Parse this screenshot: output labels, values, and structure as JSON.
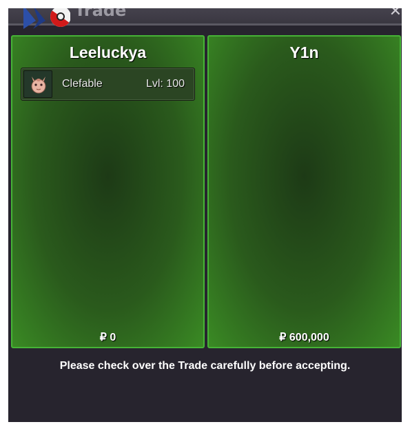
{
  "window": {
    "title": "Trade",
    "close_label": "✕"
  },
  "left_panel": {
    "trainer_name": "Leeluckya",
    "items": [
      {
        "name": "Clefable",
        "level": "Lvl: 100",
        "icon": "clefable-sprite-icon"
      }
    ],
    "money_symbol": "₽",
    "money": "0"
  },
  "right_panel": {
    "trainer_name": "Y1n",
    "items": [],
    "money_symbol": "₽",
    "money": "600,000"
  },
  "notice": "Please check over the Trade carefully before accepting.",
  "colors": {
    "panel_border": "#46b336",
    "panel_fill": "#2a5a1c",
    "window_bg": "#27242e"
  }
}
